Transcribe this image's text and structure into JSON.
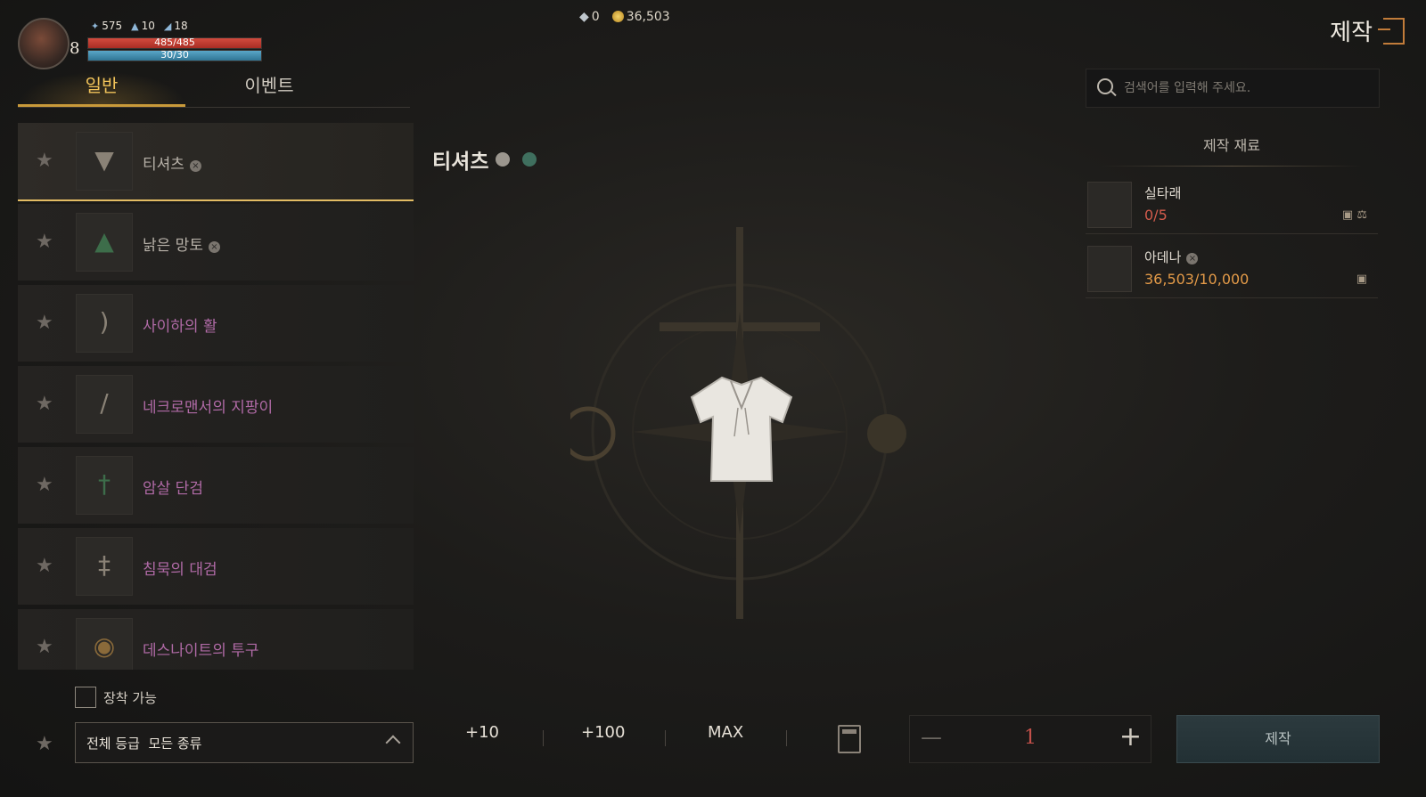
{
  "player": {
    "level": "8",
    "stat_1": "575",
    "stat_2": "10",
    "stat_3": "18",
    "hp": "485/485",
    "mp": "30/30"
  },
  "currency": {
    "gems": "0",
    "gold": "36,503"
  },
  "screen_title": "제작",
  "tabs": [
    {
      "label": "일반",
      "active": true
    },
    {
      "label": "이벤트",
      "active": false
    }
  ],
  "items": [
    {
      "name": "티셔츠",
      "rarity": "common",
      "icon": "tshirt-icon",
      "selected": true
    },
    {
      "name": "낡은 망토",
      "rarity": "common",
      "icon": "cloak-icon"
    },
    {
      "name": "사이하의 활",
      "rarity": "epic",
      "icon": "bow-icon"
    },
    {
      "name": "네크로맨서의 지팡이",
      "rarity": "epic",
      "icon": "staff-icon"
    },
    {
      "name": "암살 단검",
      "rarity": "epic",
      "icon": "dagger-icon"
    },
    {
      "name": "침묵의 대검",
      "rarity": "epic",
      "icon": "greatsword-icon"
    },
    {
      "name": "데스나이트의 투구",
      "rarity": "epic",
      "icon": "helmet-icon"
    }
  ],
  "filters": {
    "equippable_label": "장착 가능",
    "grade_select": "전체 등급",
    "type_select": "모든 종류"
  },
  "selected_item": {
    "title": "티셔츠"
  },
  "quantity": {
    "plus10": "+10",
    "plus100": "+100",
    "max": "MAX",
    "value": "1"
  },
  "craft_button": "제작",
  "search": {
    "placeholder": "검색어를 입력해 주세요."
  },
  "materials": {
    "title": "제작 재료",
    "list": [
      {
        "name": "실타래",
        "amount": "0/5",
        "amount_color": "#d25b4c"
      },
      {
        "name": "아데나",
        "amount": "36,503/10,000",
        "amount_color": "#e39a48"
      }
    ]
  },
  "colors": {
    "accent_gold": "#e3bc64",
    "epic": "#b06aa6",
    "insufficient": "#d25b4c"
  }
}
